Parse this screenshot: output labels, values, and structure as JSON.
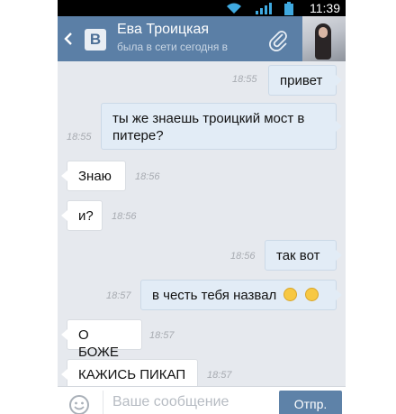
{
  "status_bar": {
    "time": "11:39"
  },
  "header": {
    "contact_name": "Ева Троицкая",
    "last_seen": "была в сети сегодня в",
    "logo_letter": "В"
  },
  "messages": [
    {
      "direction": "out",
      "text": "привет",
      "time": "18:55"
    },
    {
      "direction": "out",
      "text": "ты же знаешь троицкий мост в питере?",
      "time": "18:55"
    },
    {
      "direction": "in",
      "text": "Знаю",
      "time": "18:56"
    },
    {
      "direction": "in",
      "text": "и?",
      "time": "18:56"
    },
    {
      "direction": "out",
      "text": "так вот",
      "time": "18:56"
    },
    {
      "direction": "out",
      "text": "в честь тебя назвал",
      "time": "18:57",
      "emoji_count": 2
    },
    {
      "direction": "in",
      "text": "О БОЖЕ",
      "time": "18:57"
    },
    {
      "direction": "in",
      "text": "КАЖИСЬ ПИКАП",
      "time": "18:57"
    }
  ],
  "input": {
    "placeholder": "Ваше сообщение",
    "value": ""
  },
  "send_button": {
    "label": "Отпр."
  },
  "colors": {
    "header": "#5b7fa6",
    "outgoing_bubble": "#e2ecf6",
    "background": "#e6e9ee",
    "send": "#5e82a8"
  }
}
